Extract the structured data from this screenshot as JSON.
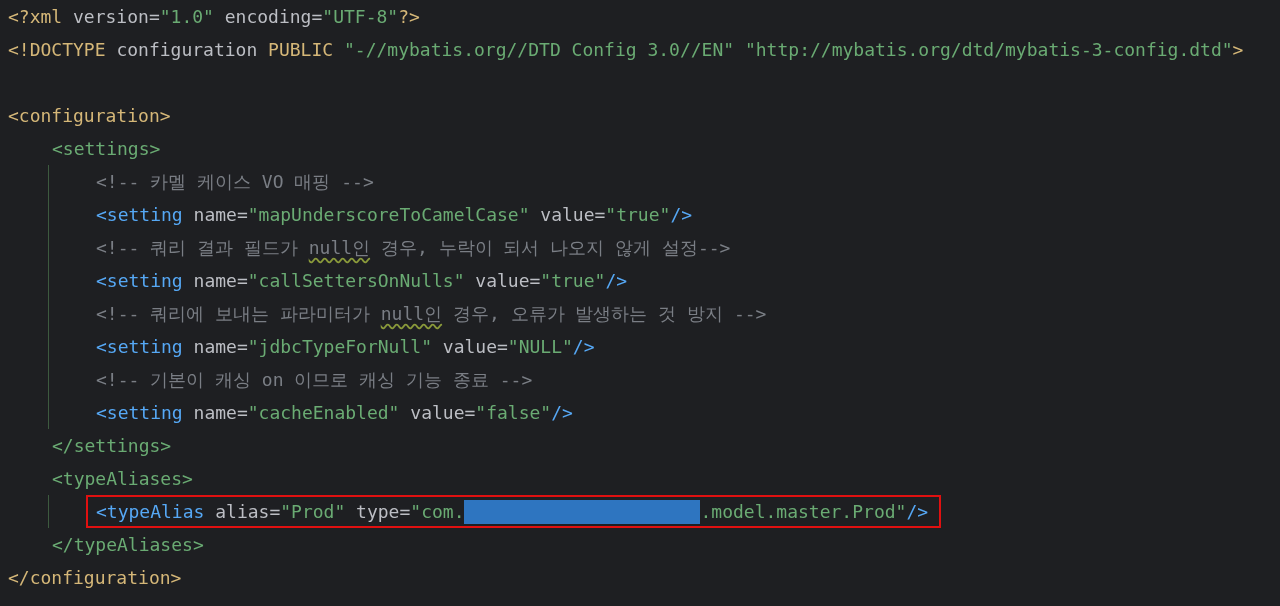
{
  "editor": {
    "lines": [
      {
        "tokens": [
          {
            "kind": "prolog",
            "text": "<?xml"
          },
          {
            "kind": "attr",
            "text": " version="
          },
          {
            "kind": "value",
            "text": "\"1.0\""
          },
          {
            "kind": "attr",
            "text": " encoding="
          },
          {
            "kind": "value",
            "text": "\"UTF-8\""
          },
          {
            "kind": "prolog",
            "text": "?>"
          }
        ]
      },
      {
        "tokens": [
          {
            "kind": "prolog",
            "text": "<!DOCTYPE"
          },
          {
            "kind": "attr",
            "text": " configuration "
          },
          {
            "kind": "prolog",
            "text": "PUBLIC"
          },
          {
            "kind": "value",
            "text": " \"-//mybatis.org//DTD Config 3.0//EN\" \"http://mybatis.org/dtd/mybatis-3-config.dtd\""
          },
          {
            "kind": "prolog",
            "text": ">"
          }
        ]
      },
      {
        "kind": "blank"
      },
      {
        "tokens": [
          {
            "kind": "prolog",
            "text": "<configuration>"
          }
        ],
        "children": [
          {
            "tokens": [
              {
                "kind": "container-tag",
                "text": "<settings>"
              }
            ],
            "children": [
              {
                "tokens": [
                  {
                    "kind": "comment",
                    "text": "<!-- 카멜 케이스 VO 매핑 -->"
                  }
                ]
              },
              {
                "tokens": [
                  {
                    "kind": "element-tag",
                    "text": "<setting"
                  },
                  {
                    "kind": "attr",
                    "text": " name="
                  },
                  {
                    "kind": "value",
                    "text": "\"mapUnderscoreToCamelCase\""
                  },
                  {
                    "kind": "attr",
                    "text": " value="
                  },
                  {
                    "kind": "value",
                    "text": "\"true\""
                  },
                  {
                    "kind": "element-tag",
                    "text": "/>"
                  }
                ]
              },
              {
                "tokens": [
                  {
                    "kind": "comment",
                    "text": "<!-- 쿼리 결과 필드가 "
                  },
                  {
                    "kind": "comment",
                    "text": "null인",
                    "flagged": true
                  },
                  {
                    "kind": "comment",
                    "text": " 경우, 누락이 되서 나오지 않게 설정-->"
                  }
                ]
              },
              {
                "tokens": [
                  {
                    "kind": "element-tag",
                    "text": "<setting"
                  },
                  {
                    "kind": "attr",
                    "text": " name="
                  },
                  {
                    "kind": "value",
                    "text": "\"callSettersOnNulls\""
                  },
                  {
                    "kind": "attr",
                    "text": " value="
                  },
                  {
                    "kind": "value",
                    "text": "\"true\""
                  },
                  {
                    "kind": "element-tag",
                    "text": "/>"
                  }
                ]
              },
              {
                "tokens": [
                  {
                    "kind": "comment",
                    "text": "<!-- 쿼리에 보내는 파라미터가 "
                  },
                  {
                    "kind": "comment",
                    "text": "null인",
                    "flagged": true
                  },
                  {
                    "kind": "comment",
                    "text": " 경우, 오류가 발생하는 것 방지 -->"
                  }
                ]
              },
              {
                "tokens": [
                  {
                    "kind": "element-tag",
                    "text": "<setting"
                  },
                  {
                    "kind": "attr",
                    "text": " name="
                  },
                  {
                    "kind": "value",
                    "text": "\"jdbcTypeForNull\""
                  },
                  {
                    "kind": "attr",
                    "text": " value="
                  },
                  {
                    "kind": "value",
                    "text": "\"NULL\""
                  },
                  {
                    "kind": "element-tag",
                    "text": "/>"
                  }
                ]
              },
              {
                "tokens": [
                  {
                    "kind": "comment",
                    "text": "<!-- 기본이 캐싱 on 이므로 캐싱 기능 종료 -->"
                  }
                ]
              },
              {
                "tokens": [
                  {
                    "kind": "element-tag",
                    "text": "<setting"
                  },
                  {
                    "kind": "attr",
                    "text": " name="
                  },
                  {
                    "kind": "value",
                    "text": "\"cacheEnabled\""
                  },
                  {
                    "kind": "attr",
                    "text": " value="
                  },
                  {
                    "kind": "value",
                    "text": "\"false\""
                  },
                  {
                    "kind": "element-tag",
                    "text": "/>"
                  }
                ]
              }
            ]
          },
          {
            "tokens": [
              {
                "kind": "container-tag",
                "text": "</settings>"
              }
            ]
          },
          {
            "tokens": [
              {
                "kind": "container-tag",
                "text": "<typeAliases>"
              }
            ],
            "children": [
              {
                "highlighted": true,
                "tokens": [
                  {
                    "kind": "element-tag",
                    "text": "<typeAlias"
                  },
                  {
                    "kind": "attr",
                    "text": " alias="
                  },
                  {
                    "kind": "value",
                    "text": "\"Prod\""
                  },
                  {
                    "kind": "attr",
                    "text": " type="
                  },
                  {
                    "kind": "value",
                    "text": "\"com."
                  },
                  {
                    "kind": "redacted"
                  },
                  {
                    "kind": "value",
                    "text": ".model.master.Prod\""
                  },
                  {
                    "kind": "element-tag",
                    "text": "/>"
                  }
                ]
              }
            ]
          },
          {
            "tokens": [
              {
                "kind": "container-tag",
                "text": "</typeAliases>"
              }
            ]
          }
        ]
      },
      {
        "tokens": [
          {
            "kind": "prolog",
            "text": "</configuration>"
          }
        ]
      }
    ]
  }
}
